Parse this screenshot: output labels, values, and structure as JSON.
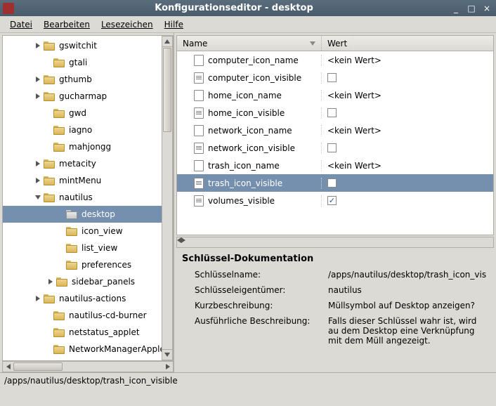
{
  "window": {
    "title": "Konfigurationseditor - desktop",
    "minimize": "_",
    "maximize": "□",
    "close": "×"
  },
  "menubar": {
    "file": "Datei",
    "edit": "Bearbeiten",
    "bookmarks": "Lesezeichen",
    "help": "Hilfe"
  },
  "tree": [
    {
      "label": "gswitchit",
      "indent": 40,
      "expander": "r"
    },
    {
      "label": "gtali",
      "indent": 54,
      "expander": ""
    },
    {
      "label": "gthumb",
      "indent": 40,
      "expander": "r"
    },
    {
      "label": "gucharmap",
      "indent": 40,
      "expander": "r"
    },
    {
      "label": "gwd",
      "indent": 54,
      "expander": ""
    },
    {
      "label": "iagno",
      "indent": 54,
      "expander": ""
    },
    {
      "label": "mahjongg",
      "indent": 54,
      "expander": ""
    },
    {
      "label": "metacity",
      "indent": 40,
      "expander": "r"
    },
    {
      "label": "mintMenu",
      "indent": 40,
      "expander": "r"
    },
    {
      "label": "nautilus",
      "indent": 40,
      "expander": "d"
    },
    {
      "label": "desktop",
      "indent": 72,
      "expander": "",
      "selected": true
    },
    {
      "label": "icon_view",
      "indent": 72,
      "expander": ""
    },
    {
      "label": "list_view",
      "indent": 72,
      "expander": ""
    },
    {
      "label": "preferences",
      "indent": 72,
      "expander": ""
    },
    {
      "label": "sidebar_panels",
      "indent": 58,
      "expander": "r"
    },
    {
      "label": "nautilus-actions",
      "indent": 40,
      "expander": "r"
    },
    {
      "label": "nautilus-cd-burner",
      "indent": 54,
      "expander": ""
    },
    {
      "label": "netstatus_applet",
      "indent": 54,
      "expander": ""
    },
    {
      "label": "NetworkManagerApplet",
      "indent": 54,
      "expander": ""
    }
  ],
  "columns": {
    "name": "Name",
    "value": "Wert"
  },
  "keys": [
    {
      "name": "computer_icon_name",
      "type": "str",
      "value": "<kein Wert>"
    },
    {
      "name": "computer_icon_visible",
      "type": "bool",
      "checked": false
    },
    {
      "name": "home_icon_name",
      "type": "str",
      "value": "<kein Wert>"
    },
    {
      "name": "home_icon_visible",
      "type": "bool",
      "checked": false
    },
    {
      "name": "network_icon_name",
      "type": "str",
      "value": "<kein Wert>"
    },
    {
      "name": "network_icon_visible",
      "type": "bool",
      "checked": false
    },
    {
      "name": "trash_icon_name",
      "type": "str",
      "value": "<kein Wert>"
    },
    {
      "name": "trash_icon_visible",
      "type": "bool",
      "checked": false,
      "selected": true
    },
    {
      "name": "volumes_visible",
      "type": "bool",
      "checked": true
    }
  ],
  "doc": {
    "title": "Schlüssel-Dokumentation",
    "rows": [
      {
        "label": "Schlüsselname:",
        "value": "/apps/nautilus/desktop/trash_icon_vis"
      },
      {
        "label": "Schlüsseleigentümer:",
        "value": "nautilus"
      },
      {
        "label": "Kurzbeschreibung:",
        "value": "Müllsymbol auf Desktop anzeigen?"
      },
      {
        "label": "Ausführliche Beschreibung:",
        "value": "Falls dieser Schlüssel wahr ist, wird au dem Desktop eine Verknüpfung mit dem Müll angezeigt."
      }
    ]
  },
  "statusbar": "/apps/nautilus/desktop/trash_icon_visible"
}
